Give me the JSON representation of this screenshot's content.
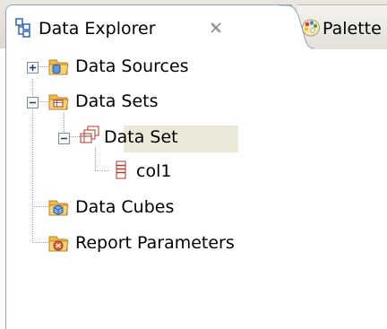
{
  "tabs": [
    {
      "label": "Data Explorer",
      "active": true,
      "icon": "data-explorer-icon",
      "close_icon": "close-icon"
    },
    {
      "label": "Palette",
      "active": false,
      "icon": "palette-icon"
    }
  ],
  "tree": {
    "items": [
      {
        "label": "Data Sources",
        "icon": "data-sources-folder-icon",
        "expander": "plus"
      },
      {
        "label": "Data Sets",
        "icon": "data-sets-folder-icon",
        "expander": "minus"
      },
      {
        "label": "Data Set",
        "icon": "data-set-icon",
        "expander": "minus",
        "selected": true
      },
      {
        "label": "col1",
        "icon": "column-icon",
        "expander": "none"
      },
      {
        "label": "Data Cubes",
        "icon": "data-cubes-folder-icon",
        "expander": "none"
      },
      {
        "label": "Report Parameters",
        "icon": "report-parameters-folder-icon",
        "expander": "none"
      }
    ]
  },
  "colors": {
    "selection": "#ece9d8",
    "folder": "#f0b94a",
    "tab_border": "#8fa3b8"
  }
}
